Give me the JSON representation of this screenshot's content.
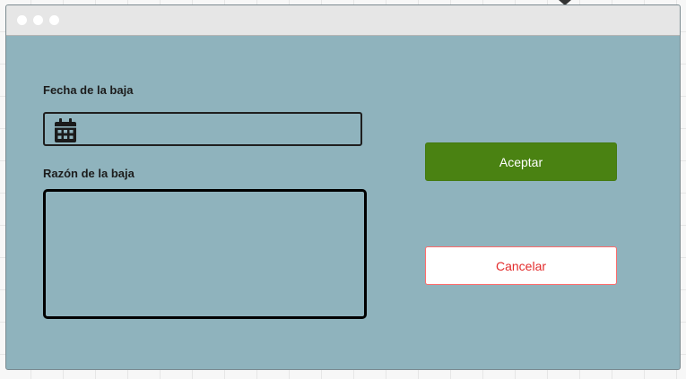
{
  "form": {
    "date_label": "Fecha de la baja",
    "date_value": "",
    "reason_label": "Razón de la baja",
    "reason_value": "",
    "date_icon": "calendar-icon"
  },
  "actions": {
    "accept_label": "Aceptar",
    "cancel_label": "Cancelar"
  },
  "colors": {
    "window_background": "#8fb3bd",
    "titlebar_background": "#e6e6e6",
    "accept_background": "#4a8212",
    "accept_text": "#ffffff",
    "cancel_border": "#ff6b6b",
    "cancel_text": "#e32b2b"
  }
}
